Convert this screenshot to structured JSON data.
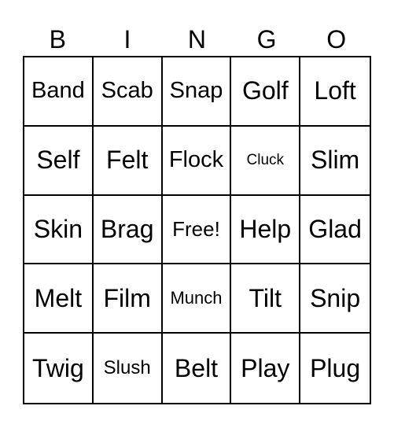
{
  "header": {
    "letters": [
      "B",
      "I",
      "N",
      "G",
      "O"
    ]
  },
  "grid": {
    "rows": [
      [
        {
          "word": "Band",
          "size": "s-28"
        },
        {
          "word": "Scab",
          "size": "s-28"
        },
        {
          "word": "Snap",
          "size": "s-28"
        },
        {
          "word": "Golf",
          "size": ""
        },
        {
          "word": "Loft",
          "size": ""
        }
      ],
      [
        {
          "word": "Self",
          "size": ""
        },
        {
          "word": "Felt",
          "size": ""
        },
        {
          "word": "Flock",
          "size": "s-28"
        },
        {
          "word": "Cluck",
          "size": "s-18"
        },
        {
          "word": "Slim",
          "size": ""
        }
      ],
      [
        {
          "word": "Skin",
          "size": ""
        },
        {
          "word": "Brag",
          "size": ""
        },
        {
          "word": "Free!",
          "size": "s-26"
        },
        {
          "word": "Help",
          "size": ""
        },
        {
          "word": "Glad",
          "size": ""
        }
      ],
      [
        {
          "word": "Melt",
          "size": ""
        },
        {
          "word": "Film",
          "size": ""
        },
        {
          "word": "Munch",
          "size": "s-21"
        },
        {
          "word": "Tilt",
          "size": ""
        },
        {
          "word": "Snip",
          "size": ""
        }
      ],
      [
        {
          "word": "Twig",
          "size": ""
        },
        {
          "word": "Slush",
          "size": "s-24"
        },
        {
          "word": "Belt",
          "size": ""
        },
        {
          "word": "Play",
          "size": ""
        },
        {
          "word": "Plug",
          "size": ""
        }
      ]
    ]
  }
}
